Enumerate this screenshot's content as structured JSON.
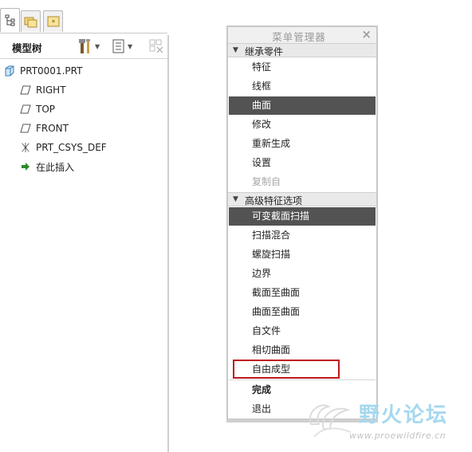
{
  "model_tree": {
    "title": "模型树",
    "items": [
      {
        "label": "PRT0001.PRT",
        "icon": "part-icon"
      },
      {
        "label": "RIGHT",
        "icon": "datum-plane-icon"
      },
      {
        "label": "TOP",
        "icon": "datum-plane-icon"
      },
      {
        "label": "FRONT",
        "icon": "datum-plane-icon"
      },
      {
        "label": "PRT_CSYS_DEF",
        "icon": "coordinate-system-icon"
      },
      {
        "label": "在此插入",
        "icon": "insert-arrow-icon"
      }
    ]
  },
  "menu_manager": {
    "title": "菜单管理器",
    "close": "×",
    "section1": {
      "label": "继承零件",
      "items": [
        {
          "label": "特征",
          "state": "normal"
        },
        {
          "label": "线框",
          "state": "normal"
        },
        {
          "label": "曲面",
          "state": "selected"
        },
        {
          "label": "修改",
          "state": "normal"
        },
        {
          "label": "重新生成",
          "state": "normal"
        },
        {
          "label": "设置",
          "state": "normal"
        },
        {
          "label": "复制自",
          "state": "disabled"
        }
      ]
    },
    "section2": {
      "label": "高级特征选项",
      "items": [
        {
          "label": "可变截面扫描",
          "state": "selected"
        },
        {
          "label": "扫描混合",
          "state": "normal"
        },
        {
          "label": "螺旋扫描",
          "state": "normal"
        },
        {
          "label": "边界",
          "state": "normal"
        },
        {
          "label": "截面至曲面",
          "state": "normal"
        },
        {
          "label": "曲面至曲面",
          "state": "normal"
        },
        {
          "label": "自文件",
          "state": "normal"
        },
        {
          "label": "相切曲面",
          "state": "normal"
        },
        {
          "label": "自由成型",
          "state": "highlighted"
        }
      ]
    },
    "done": "完成",
    "quit": "退出"
  },
  "watermark": {
    "text": "野火论坛",
    "url": "www.proewildfire.cn"
  },
  "colors": {
    "selected_bg": "#535353",
    "highlight_border": "#c0171c",
    "watermark": "#a5d8ef"
  }
}
